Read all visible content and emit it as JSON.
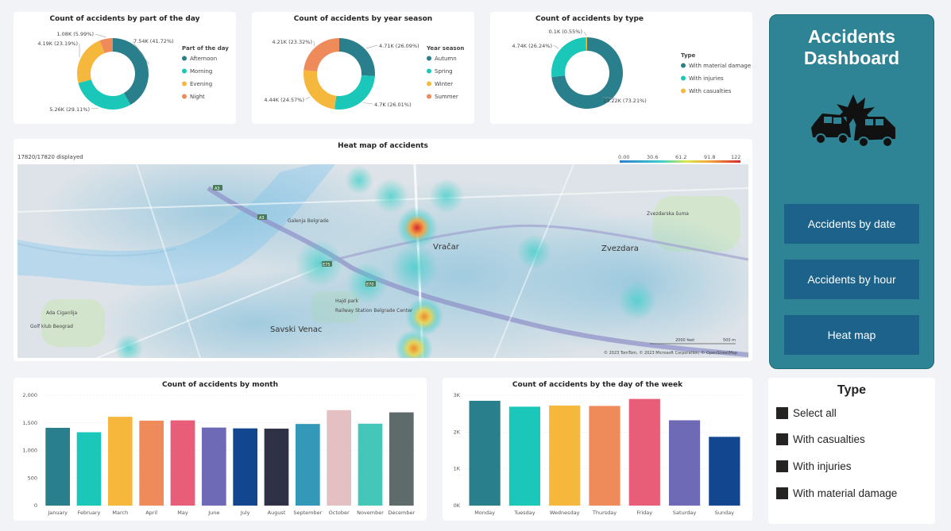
{
  "colors": {
    "teal": "#2a7f8d",
    "cyan": "#1bc7b8",
    "yellow": "#f5b83d",
    "orange": "#ef8a5b",
    "pink": "#e85d78",
    "purple": "#6e6ab5",
    "navy": "#12468e",
    "dark": "#2f3146",
    "blue": "#3499b8",
    "rose": "#e4c0c3",
    "mint": "#44c6b8",
    "slate": "#5f6b6b",
    "panel": "#2e8494",
    "button": "#1c628a"
  },
  "donut_part_of_day": {
    "title": "Count of accidents by part of the day",
    "legend_title": "Part of the day",
    "chart_data": {
      "type": "pie",
      "title": "Count of accidents by part of the day",
      "legend_title": "Part of the day",
      "slices": [
        {
          "name": "Afternoon",
          "value": 7540,
          "label": "7.54K (41.72%)",
          "color": "#2a7f8d"
        },
        {
          "name": "Morning",
          "value": 5260,
          "label": "5.26K (29.11%)",
          "color": "#1bc7b8"
        },
        {
          "name": "Evening",
          "value": 4190,
          "label": "4.19K (23.19%)",
          "color": "#f5b83d"
        },
        {
          "name": "Night",
          "value": 1080,
          "label": "1.08K (5.99%)",
          "color": "#ef8a5b"
        }
      ]
    }
  },
  "donut_season": {
    "title": "Count of accidents by year season",
    "legend_title": "Year season",
    "chart_data": {
      "type": "pie",
      "title": "Count of accidents by year season",
      "legend_title": "Year season",
      "slices": [
        {
          "name": "Autumn",
          "value": 4710,
          "label": "4.71K (26.09%)",
          "color": "#2a7f8d"
        },
        {
          "name": "Spring",
          "value": 4700,
          "label": "4.7K (26.01%)",
          "color": "#1bc7b8"
        },
        {
          "name": "Winter",
          "value": 4440,
          "label": "4.44K (24.57%)",
          "color": "#f5b83d"
        },
        {
          "name": "Summer",
          "value": 4210,
          "label": "4.21K (23.32%)",
          "color": "#ef8a5b"
        }
      ]
    }
  },
  "donut_type": {
    "title": "Count of accidents by type",
    "legend_title": "Type",
    "chart_data": {
      "type": "pie",
      "title": "Count of accidents by type",
      "legend_title": "Type",
      "slices": [
        {
          "name": "With material damage",
          "value": 13220,
          "label": "13.22K (73.21%)",
          "color": "#2a7f8d"
        },
        {
          "name": "With injuries",
          "value": 4740,
          "label": "4.74K (26.24%)",
          "color": "#1bc7b8"
        },
        {
          "name": "With casualties",
          "value": 100,
          "label": "0.1K (0.55%)",
          "color": "#f5b83d"
        }
      ]
    }
  },
  "heatmap": {
    "title": "Heat map of accidents",
    "displayed": "17820/17820 displayed",
    "scale_ticks": [
      "0.00",
      "30.6",
      "61.2",
      "91.8",
      "122"
    ],
    "places": [
      "Vračar",
      "Zvezdara",
      "Savski Venac",
      "Zvezdarska šuma",
      "Railway Station Belgrade Center",
      "Ada Ciganlija",
      "Golf klub Beograd",
      "Galenja Belgrade",
      "Hajd park"
    ],
    "roads": [
      "A3",
      "E70",
      "E75"
    ],
    "attribution": "© 2023 TomTom, © 2023 Microsoft Corporation, © OpenStreetMap",
    "scale_ft": "2000 feet",
    "scale_m": "500 m"
  },
  "month_chart": {
    "title": "Count of accidents by month",
    "chart_data": {
      "type": "bar",
      "title": "Count of accidents by month",
      "categories": [
        "January",
        "February",
        "March",
        "April",
        "May",
        "June",
        "July",
        "August",
        "September",
        "October",
        "November",
        "December"
      ],
      "values": [
        1410,
        1330,
        1610,
        1540,
        1545,
        1415,
        1400,
        1395,
        1480,
        1730,
        1485,
        1690
      ],
      "ylim": [
        0,
        2000
      ],
      "yticks": [
        0,
        500,
        1000,
        1500,
        2000
      ],
      "ytick_labels": [
        "0",
        "500",
        "1,000",
        "1,500",
        "2,000"
      ],
      "colors": [
        "#2a7f8d",
        "#1bc7b8",
        "#f5b83d",
        "#ef8a5b",
        "#e85d78",
        "#6e6ab5",
        "#12468e",
        "#2f3146",
        "#3499b8",
        "#e4c0c3",
        "#44c6b8",
        "#5f6b6b"
      ]
    }
  },
  "weekday_chart": {
    "title": "Count of accidents by the day of the week",
    "chart_data": {
      "type": "bar",
      "title": "Count of accidents by the day of the week",
      "categories": [
        "Monday",
        "Tuesday",
        "Wednesday",
        "Thursday",
        "Friday",
        "Saturday",
        "Sunday"
      ],
      "values": [
        2850,
        2690,
        2720,
        2710,
        2900,
        2320,
        1870
      ],
      "ylim": [
        0,
        3000
      ],
      "yticks": [
        0,
        1000,
        2000,
        3000
      ],
      "ytick_labels": [
        "0K",
        "1K",
        "2K",
        "3K"
      ],
      "colors": [
        "#2a7f8d",
        "#1bc7b8",
        "#f5b83d",
        "#ef8a5b",
        "#e85d78",
        "#6e6ab5",
        "#12468e"
      ]
    }
  },
  "side": {
    "title_line1": "Accidents",
    "title_line2": "Dashboard",
    "buttons": [
      "Accidents by date",
      "Accidents by hour",
      "Heat map"
    ]
  },
  "slicer": {
    "title": "Type",
    "items": [
      "Select all",
      "With casualties",
      "With injuries",
      "With material damage"
    ]
  }
}
